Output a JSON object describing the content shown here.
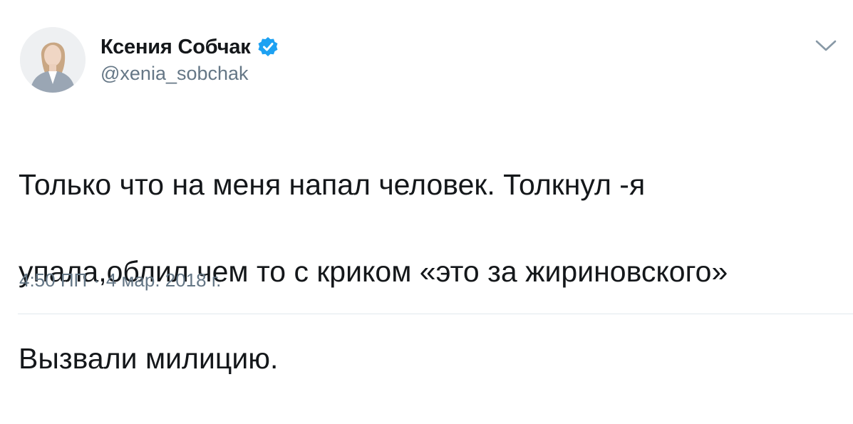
{
  "author": {
    "display_name": "Ксения Собчак",
    "handle": "@xenia_sobchak",
    "verified_icon": "verified-badge-icon",
    "verified_color": "#1da1f2"
  },
  "tweet": {
    "text_lines": [
      "Только что на меня напал человек. Толкнул -я",
      "упала,облил чем то с криком «это за жириновского»",
      "Вызвали милицию."
    ],
    "time": "4:50 ПП",
    "separator": "·",
    "date": "4 мар. 2018 г."
  },
  "menu": {
    "icon": "chevron-down-icon"
  },
  "colors": {
    "text": "#14171a",
    "secondary": "#657786",
    "divider": "#e1e8ed"
  }
}
